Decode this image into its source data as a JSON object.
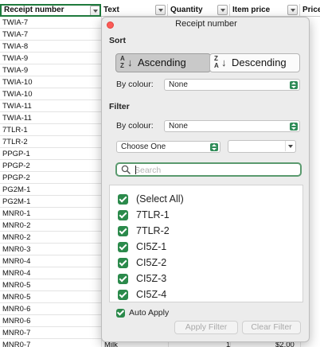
{
  "sheet": {
    "headers": [
      "Receipt number",
      "Text",
      "Quantity",
      "Item price",
      "Price"
    ],
    "receipt_numbers": [
      "TWIA-7",
      "TWIA-7",
      "TWIA-8",
      "TWIA-9",
      "TWIA-9",
      "TWIA-10",
      "TWIA-10",
      "TWIA-11",
      "TWIA-11",
      "7TLR-1",
      "7TLR-2",
      "PPGP-1",
      "PPGP-2",
      "PPGP-2",
      "PG2M-1",
      "PG2M-1",
      "MNR0-1",
      "MNR0-2",
      "MNR0-2",
      "MNR0-3",
      "MNR0-4",
      "MNR0-4",
      "MNR0-5",
      "MNR0-5",
      "MNR0-6",
      "MNR0-6",
      "MNR0-7",
      "MNR0-7"
    ],
    "last_row": {
      "text": "Milk",
      "quantity": "1",
      "item_price": "$2.00"
    }
  },
  "popup": {
    "title": "Receipt number",
    "sort": {
      "section_label": "Sort",
      "ascending_label": "Ascending",
      "descending_label": "Descending",
      "asc_icon_top": "A",
      "asc_icon_bottom": "Z",
      "desc_icon_top": "Z",
      "desc_icon_bottom": "A",
      "by_colour_label": "By colour:",
      "by_colour_value": "None"
    },
    "filter": {
      "section_label": "Filter",
      "by_colour_label": "By colour:",
      "by_colour_value": "None",
      "choose_one_value": "Choose One",
      "criteria_value": "",
      "search_placeholder": "Search",
      "items": [
        "(Select All)",
        "7TLR-1",
        "7TLR-2",
        "CI5Z-1",
        "CI5Z-2",
        "CI5Z-3",
        "CI5Z-4"
      ],
      "auto_apply_label": "Auto Apply",
      "apply_filter_label": "Apply Filter",
      "clear_filter_label": "Clear Filter"
    }
  },
  "colors": {
    "accent_green": "#2b8a4b",
    "close_red": "#fc5b57"
  }
}
